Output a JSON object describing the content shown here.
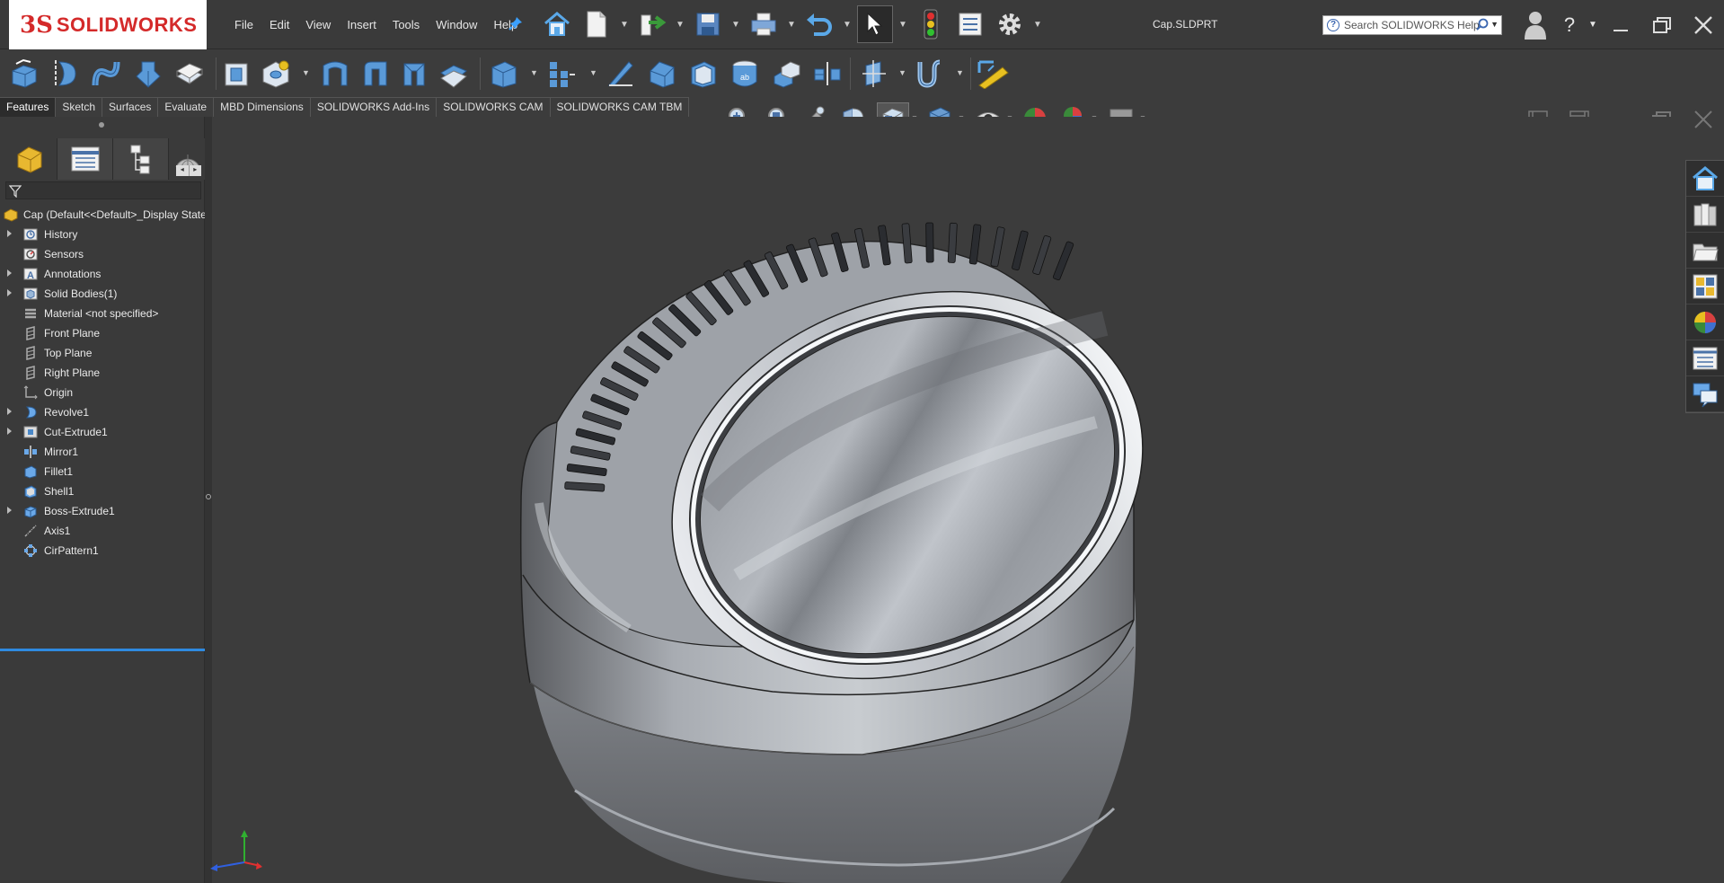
{
  "app": {
    "brand": "SOLIDWORKS",
    "logo_mark": "3S",
    "document_title": "Cap.SLDPRT"
  },
  "menu": [
    "File",
    "Edit",
    "View",
    "Insert",
    "Tools",
    "Window",
    "Help"
  ],
  "search": {
    "placeholder": "Search SOLIDWORKS Help"
  },
  "command_tabs": [
    {
      "label": "Features",
      "active": true
    },
    {
      "label": "Sketch",
      "active": false
    },
    {
      "label": "Surfaces",
      "active": false
    },
    {
      "label": "Evaluate",
      "active": false
    },
    {
      "label": "MBD Dimensions",
      "active": false
    },
    {
      "label": "SOLIDWORKS Add-Ins",
      "active": false
    },
    {
      "label": "SOLIDWORKS CAM",
      "active": false
    },
    {
      "label": "SOLIDWORKS CAM TBM",
      "active": false
    }
  ],
  "tree": {
    "root": "Cap  (Default<<Default>_Display State",
    "items": [
      {
        "label": "History",
        "icon": "history-icon",
        "expandable": true
      },
      {
        "label": "Sensors",
        "icon": "sensors-icon",
        "expandable": false
      },
      {
        "label": "Annotations",
        "icon": "annotations-icon",
        "expandable": true
      },
      {
        "label": "Solid Bodies(1)",
        "icon": "solid-bodies-icon",
        "expandable": true
      },
      {
        "label": "Material <not specified>",
        "icon": "material-icon",
        "expandable": false
      },
      {
        "label": "Front Plane",
        "icon": "plane-icon",
        "expandable": false
      },
      {
        "label": "Top Plane",
        "icon": "plane-icon",
        "expandable": false
      },
      {
        "label": "Right Plane",
        "icon": "plane-icon",
        "expandable": false
      },
      {
        "label": "Origin",
        "icon": "origin-icon",
        "expandable": false
      },
      {
        "label": "Revolve1",
        "icon": "revolve-icon",
        "expandable": true
      },
      {
        "label": "Cut-Extrude1",
        "icon": "cut-extrude-icon",
        "expandable": true
      },
      {
        "label": "Mirror1",
        "icon": "mirror-icon",
        "expandable": false
      },
      {
        "label": "Fillet1",
        "icon": "fillet-icon",
        "expandable": false
      },
      {
        "label": "Shell1",
        "icon": "shell-icon",
        "expandable": false
      },
      {
        "label": "Boss-Extrude1",
        "icon": "boss-extrude-icon",
        "expandable": true
      },
      {
        "label": "Axis1",
        "icon": "axis-icon",
        "expandable": false
      },
      {
        "label": "CirPattern1",
        "icon": "circular-pattern-icon",
        "expandable": false
      }
    ]
  },
  "colors": {
    "accent": "#2f8ae0",
    "brand_red": "#d42a2a",
    "background": "#3c3c3c"
  }
}
